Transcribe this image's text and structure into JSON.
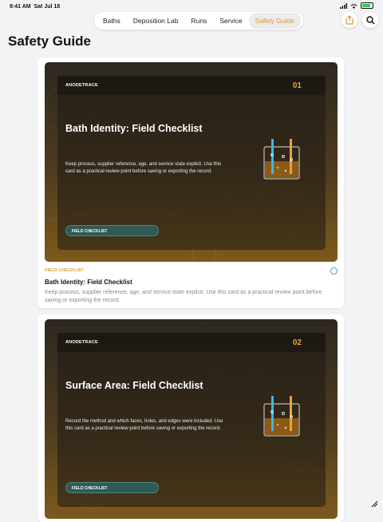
{
  "status": {
    "time": "9:41 AM",
    "date": "Sat Jul 18",
    "battery_level": 0.8
  },
  "nav": {
    "tabs": [
      "Baths",
      "Deposition Lab",
      "Runs",
      "Service",
      "Safety Guide"
    ],
    "active_index": 4
  },
  "page": {
    "title": "Safety Guide"
  },
  "cards": [
    {
      "brand": "ANODETRACE",
      "number": "01",
      "hero_title": "Bath Identity: Field Checklist",
      "hero_desc": "Keep process, supplier reference, age, and service state explicit. Use this card as a practical review point before saving or exporting the record.",
      "chip": "FIELD CHECKLIST",
      "meta": "FIELD CHECKLIST",
      "title": "Bath Identity: Field Checklist",
      "desc": "Keep process, supplier reference, age, and service state explicit. Use this card as a practical review point before saving or exporting the record."
    },
    {
      "brand": "ANODETRACE",
      "number": "02",
      "hero_title": "Surface Area: Field Checklist",
      "hero_desc": "Record the method and which faces, holes, and edges were included. Use this card as a practical review point before saving or exporting the record.",
      "chip": "FIELD CHECKLIST"
    }
  ],
  "icons": {
    "share": "share-icon",
    "search": "search-icon",
    "checkmark": "checkmark-icon"
  },
  "colors": {
    "accent": "#d89a2b",
    "chip": "#2f5a55",
    "beaker_blue": "#3cb8e8",
    "beaker_orange": "#e8a43a"
  }
}
